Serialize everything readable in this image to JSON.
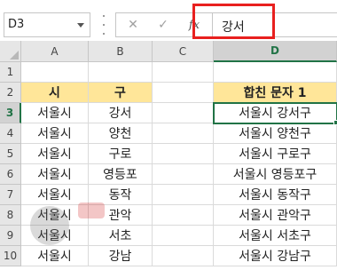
{
  "formula_bar": {
    "name_box": "D3",
    "cancel_symbol": "✕",
    "enter_symbol": "✓",
    "fx_label": "fx",
    "formula_value": "강서",
    "highlight_color": "#e8201f"
  },
  "sheet": {
    "columns": [
      "A",
      "B",
      "C",
      "D"
    ],
    "rows": [
      "1",
      "2",
      "3",
      "4",
      "5",
      "6",
      "7",
      "8",
      "9",
      "10"
    ],
    "active_column": "D",
    "active_row": "3",
    "header_fill_color": "#ffe699",
    "selection_color": "#217346",
    "headers": {
      "a2": "시",
      "b2": "구",
      "d2": "합친 문자 1"
    },
    "data_rows": [
      {
        "row": "3",
        "a": "서울시",
        "b": "강서",
        "d": "서울시 강서구"
      },
      {
        "row": "4",
        "a": "서울시",
        "b": "양천",
        "d": "서울시 양천구"
      },
      {
        "row": "5",
        "a": "서울시",
        "b": "구로",
        "d": "서울시 구로구"
      },
      {
        "row": "6",
        "a": "서울시",
        "b": "영등포",
        "d": "서울시 영등포구"
      },
      {
        "row": "7",
        "a": "서울시",
        "b": "동작",
        "d": "서울시 동작구"
      },
      {
        "row": "8",
        "a": "서울시",
        "b": "관악",
        "d": "서울시 관악구"
      },
      {
        "row": "9",
        "a": "서울시",
        "b": "서초",
        "d": "서울시 서초구"
      },
      {
        "row": "10",
        "a": "서울시",
        "b": "강남",
        "d": "서울시 강남구"
      }
    ]
  }
}
